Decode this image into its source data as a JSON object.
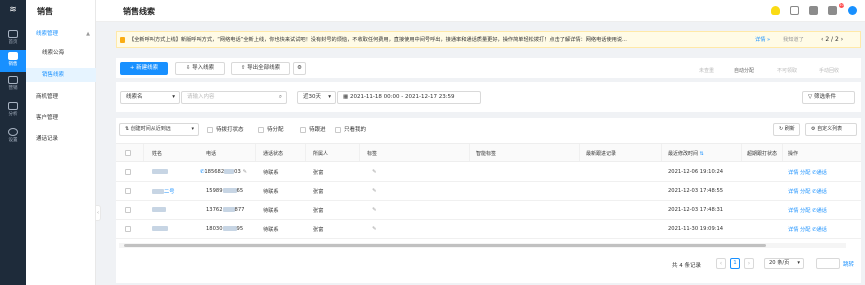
{
  "rail": {
    "items": [
      {
        "label": "首页"
      },
      {
        "label": "销售"
      },
      {
        "label": "营销"
      },
      {
        "label": "分析"
      },
      {
        "label": "设置"
      }
    ]
  },
  "submenu": {
    "title": "销售",
    "group": "线索管理",
    "children": [
      "线索公海",
      "销售线索"
    ],
    "others": [
      "商机管理",
      "客户管理",
      "通话记录"
    ]
  },
  "header": {
    "title": "销售线索",
    "badge": "10"
  },
  "notice": {
    "text": "【全新呼叫方式上线】新版呼叫方式，“网络电话”全新上线，你也快来试试吧！没有封号的烦恼，不收取任何费用，直接使用中间号呼出，接通率和通话质量更好，操作简单轻松拨打！点击了解详情：网络电话使用说...",
    "details": "详情 »",
    "known": "我知道了",
    "page": "2 / 2"
  },
  "toolbar": {
    "new": "+ 新建线索",
    "import": "导入线索",
    "export": "导出全部线索",
    "right": [
      "未查重",
      "自动分配",
      "不可领取",
      "手动回收"
    ]
  },
  "filter": {
    "field": "线索名",
    "placeholder": "请输入内容",
    "range": "近30天",
    "dates": "2021-11-18 00:00 - 2021-12-17 23:59",
    "condition": "筛选条件"
  },
  "table": {
    "sort": "创建时间从近到远",
    "quick": [
      "待拨打状态",
      "待分配",
      "待跟进",
      "只看我的"
    ],
    "refresh": "刷新",
    "customize": "自定义列表",
    "columns": [
      "姓名",
      "电话",
      "通话状态",
      "所属人",
      "标签",
      "智能标签",
      "最新跟进记录",
      "最近修改时间",
      "超期跟打状态",
      "操作"
    ],
    "rows": [
      {
        "name_suffix": "",
        "phone": "185682",
        "phone_suffix": "03",
        "status": "待联系",
        "owner": "张富",
        "time": "2021-12-06 19:10:24"
      },
      {
        "name_suffix": "二号",
        "phone": "15989",
        "phone_suffix": "65",
        "status": "待联系",
        "owner": "张富",
        "time": "2021-12-03 17:48:55"
      },
      {
        "name_suffix": "",
        "phone": "13762",
        "phone_suffix": "877",
        "status": "待联系",
        "owner": "张富",
        "time": "2021-12-03 17:48:31"
      },
      {
        "name_suffix": "",
        "phone": "18030",
        "phone_suffix": "95",
        "status": "待联系",
        "owner": "张富",
        "time": "2021-11-30 19:09:14"
      }
    ],
    "actions": [
      "详情",
      "分配",
      "通话"
    ]
  },
  "pager": {
    "total": "共 4 条记录",
    "current": "1",
    "size": "20 条/页",
    "goto": "跳转"
  }
}
